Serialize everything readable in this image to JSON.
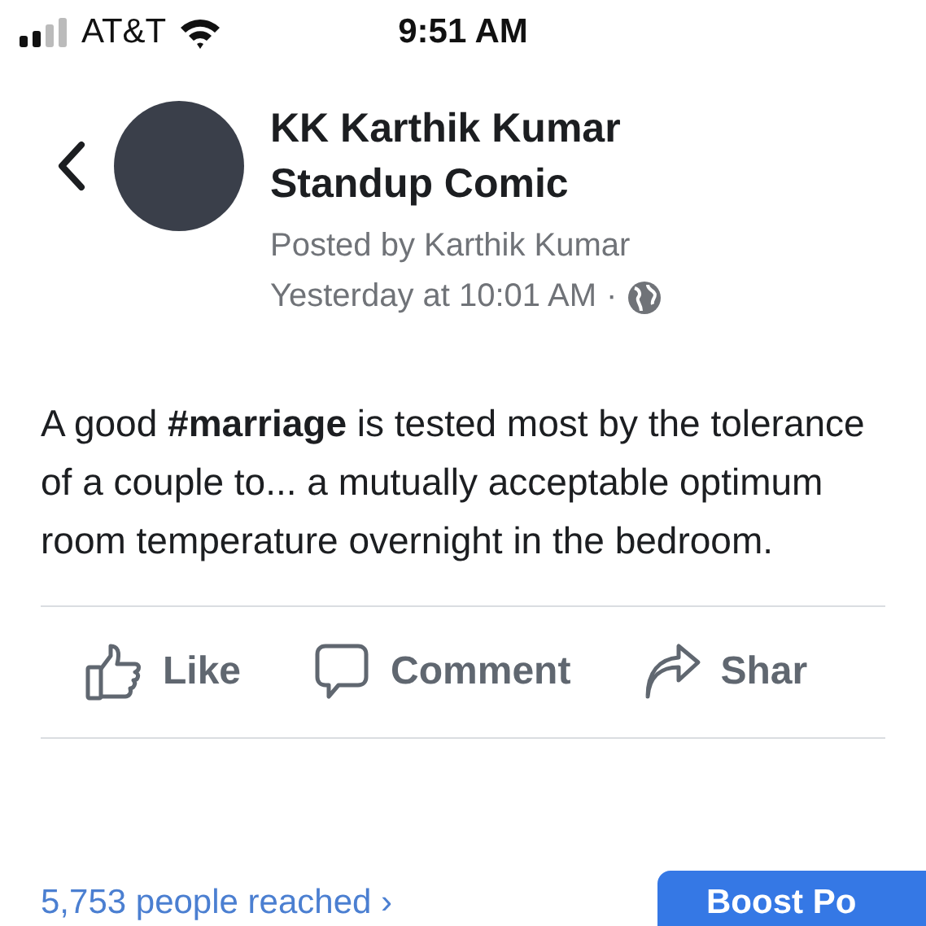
{
  "status_bar": {
    "carrier": "AT&T",
    "time": "9:51 AM"
  },
  "post": {
    "page_name": "KK Karthik Kumar Standup Comic",
    "posted_by": "Posted by Karthik Kumar",
    "timestamp": "Yesterday at 10:01 AM",
    "separator": "·",
    "text": "A good **#marriage** is tested most by the tolerance of a couple to... a mutually acceptable optimum room temperature overnight in the bedroom."
  },
  "actions": [
    {
      "kind": "like",
      "label": "Like"
    },
    {
      "kind": "comment",
      "label": "Comment"
    },
    {
      "kind": "share",
      "label": "Shar"
    }
  ],
  "footer": {
    "reach": "5,753 people reached ›",
    "button": "Boost Po"
  }
}
